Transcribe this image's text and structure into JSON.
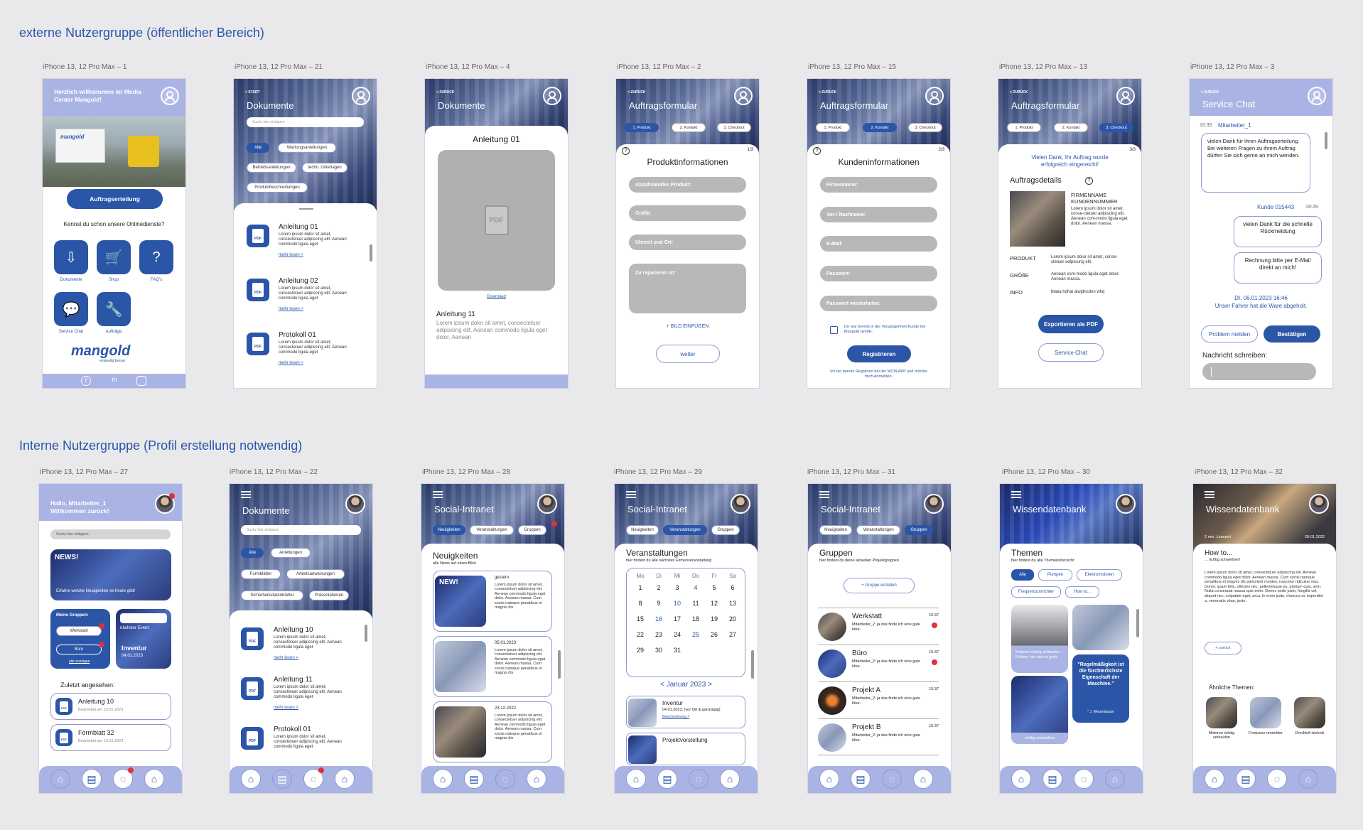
{
  "sections": {
    "external": "externe Nutzergruppe (öffentlicher Bereich)",
    "internal": "Interne Nutzergruppe (Profil erstellung notwendig)"
  },
  "labels": {
    "a1": "iPhone 13, 12 Pro Max – 1",
    "a21": "iPhone 13, 12 Pro Max – 21",
    "a4": "iPhone 13, 12 Pro Max – 4",
    "a2": "iPhone 13, 12 Pro Max – 2",
    "a15": "iPhone 13, 12 Pro Max – 15",
    "a13": "iPhone 13, 12 Pro Max – 13",
    "a3": "iPhone 13, 12 Pro Max – 3",
    "a27": "iPhone 13, 12 Pro Max – 27",
    "a22": "iPhone 13, 12 Pro Max – 22",
    "a28": "iPhone 13, 12 Pro Max – 28",
    "a29": "iPhone 13, 12 Pro Max – 29",
    "a31": "iPhone 13, 12 Pro Max – 31",
    "a30": "iPhone 13, 12 Pro Max – 30",
    "a32": "iPhone 13, 12 Pro Max – 32"
  },
  "colors": {
    "accent": "#2b56a8",
    "header": "#aab4e4",
    "field": "#b8b8b8",
    "alert": "#e0303c"
  },
  "icons": {
    "user": "user-icon",
    "home": "home-icon",
    "pdf": "pdf-icon",
    "chat": "chat-icon",
    "learn": "graduation-cap-icon"
  },
  "s1": {
    "welcome": "Herzlich willkommen im Media Center Mangold!",
    "cta": "Auftragserteilung",
    "question": "Kennst du schon unsere Onlinedienste?",
    "tiles": [
      "Dokumente",
      "Shop",
      "FAQ's",
      "Service Chat",
      "Aufträge"
    ],
    "logo": "mangold",
    "logo_sub": "eindeutig besser"
  },
  "s21": {
    "back": "< START",
    "title": "Dokumente",
    "search": "Suche hier eintippen",
    "filters": [
      "Alle",
      "Wartungsanleitungen",
      "Betriebsanleitungen",
      "techn. Unterlagen",
      "Produktbeschreibungen"
    ],
    "docs": [
      {
        "title": "Anleitung 01",
        "text": "Lorem ipsum dolor sit amet, consectetuer adipiscing elit. Aenean commodo ligula eget",
        "more": "mehr lesen >"
      },
      {
        "title": "Anleitung 02",
        "text": "Lorem ipsum dolor sit amet, consectetuer adipiscing elit. Aenean commodo ligula eget",
        "more": "mehr lesen >"
      },
      {
        "title": "Protokoll 01",
        "text": "Lorem ipsum dolor sit amet, consectetuer adipiscing elit. Aenean commodo ligula eget",
        "more": "mehr lesen >"
      }
    ]
  },
  "s4": {
    "back": "< ZURÜCK",
    "title": "Dokumente",
    "doc_title": "Anleitung 01",
    "pdf": "PDF",
    "download": "Download",
    "next_title": "Anleitung 11",
    "next_text": "Lorem ipsum dolor sit amet, consectetuer adipiscing elit. Aenean commodo ligula eget dolor. Aenean"
  },
  "form": {
    "back": "< ZURÜCK",
    "title": "Auftragsformular",
    "steps": [
      "1. Produkt",
      "2. Kontakt",
      "3. Checkout"
    ]
  },
  "s2": {
    "page": "1/3",
    "heading": "Produktinformationen",
    "fields": [
      "Abzuholendes Produkt:",
      "Größe:",
      "Uhrzeit und Ort:",
      "Zu reparieren ist:"
    ],
    "add_image": "+ BILD EINFÜGEN",
    "next": "weiter"
  },
  "s15": {
    "page": "2/3",
    "heading": "Kundeninformationen",
    "fields": [
      "Firmenname:",
      "Vor-/ Nachname:",
      "E-Mail:",
      "Passwort:",
      "Passwort wiederholen:"
    ],
    "checkbox": "Ich war bereits in der Vorgangenheit Kunde bei Mangold GmbH.",
    "register": "Registrieren",
    "login_note": "Ich bin bereits Registriert bei der MCM-APP und möchte mich Anmelden."
  },
  "s13": {
    "page": "3/3",
    "thanks": "Vielen Dank, Ihr Auftrag wurde erfolgreich eingereicht!",
    "heading": "Auftragsdetails",
    "company": "FIRMENNAME KUNDENNUMMER",
    "company_text": "Lorem ipsum dolor sit amet, conse-ctetuer adipiscing elit. Aenean com-modo ligula eget dolor. Aenean massa.",
    "rows": [
      {
        "k": "PRODUKT",
        "v": "Lorem ipsum dolor sit amet, conse-ctetuer adipiscing elit."
      },
      {
        "k": "GRÖßE",
        "v": "Aenean com-modo ligula eget dolor. Aenean massa."
      },
      {
        "k": "INFO",
        "v": "blaba hdhai  alwjdnsdnn whd"
      }
    ],
    "export": "Exportieren als PDF",
    "chat": "Service Chat"
  },
  "s3": {
    "back": "< ZURÜCK",
    "title": "Service Chat",
    "time1": "16:35",
    "agent": "Mitarbeiter_1",
    "msg1": "vielen Dank für ihren Auftragserteilung. Bei weiteren Fragen zu ihrem Auftrag dürfen Sie sich gerne an mich wenden.",
    "customer": "Kunde 015443",
    "time2": "19:29",
    "msg2": "vielen Dank für die schnelle Rückmeldung",
    "msg3": "Rechnung bitte per E-Mail direkt an mich!",
    "status_date": "DI, 06.01.2023 16:46",
    "status": "Unser Fahrer hat die Ware abgeholt.",
    "problem": "Problem melden",
    "confirm": "Bestätigen",
    "compose": "Nachricht schreiben:"
  },
  "s27": {
    "greeting": "Hallo, Mitarbeiter_1 Willkommen zurück!",
    "search": "Suche hier eintippen",
    "news_badge": "NEWS!",
    "news_text": "Erfahre welche Neuigkeiten es heute gibt!",
    "groups_title": "Meine Gruppen:",
    "groups": [
      "Werkstatt",
      "Büro"
    ],
    "groups_more": "alle anzeigen",
    "event_title": "nächster Event:",
    "event_name": "Inventur",
    "event_date": "04.01.2023",
    "recent_title": "Zuletzt angesehen:",
    "recent": [
      {
        "title": "Anleitung 10",
        "edited": "Bearbeitet am 15.01.2023"
      },
      {
        "title": "Formblatt 32",
        "edited": "Bearbeitet am 15.01.2023"
      }
    ]
  },
  "s22": {
    "title": "Dokumente",
    "search": "Suche hier eintippen",
    "filters": [
      "Alle",
      "Anleitungen",
      "Formblätter",
      "Arbeitsanweisungen",
      "Sicherheitsdatenblätter",
      "Präsentationen"
    ],
    "docs": [
      {
        "title": "Anleitung 10",
        "text": "Lorem ipsum dolor sit amet, consectetuer adipiscing elit. Aenean commodo ligula eget",
        "more": "mehr lesen >"
      },
      {
        "title": "Anleitung 11",
        "text": "Lorem ipsum dolor sit amet, consectetuer adipiscing elit. Aenean commodo ligula eget",
        "more": "mehr lesen >"
      },
      {
        "title": "Protokoll 01",
        "text": "Lorem ipsum dolor sit amet, consectetuer adipiscing elit. Aenean commodo ligula eget",
        "more": "mehr lesen >"
      }
    ]
  },
  "intranet": {
    "title": "Social-Intranet",
    "tabs": [
      "Neuigkeiten",
      "Veranstaltungen",
      "Gruppen"
    ]
  },
  "s28": {
    "heading": "Neuigkeiten",
    "sub": "alle News auf einen Blick",
    "badge": "NEW!",
    "posts": [
      {
        "date": "gestern",
        "text": "Lorem ipsum dolor sit amet, consectetuer adipiscing elit. Aenean commodo ligula eget dolor. Aenean massa. Cum sociis natoque penatibus et magnis dis"
      },
      {
        "date": "05.01.2023",
        "text": "Lorem ipsum dolor sit amet, consectetuer adipiscing elit. Aenean commodo ligula eget dolor. Aenean massa. Cum sociis natoque penatibus et magnis dis"
      },
      {
        "date": "23.12.2022",
        "text": "Lorem ipsum dolor sit amet, consectetuer adipiscing elit. Aenean commodo ligula eget dolor. Aenean massa. Cum sociis natoque penatibus et magnis dis"
      }
    ]
  },
  "s29": {
    "heading": "Veranstaltungen",
    "sub": "hier findest du alle nächsten Firmenveranstaltung",
    "weekdays": [
      "Mo",
      "Di",
      "Mi",
      "Do",
      "Fr",
      "Sa"
    ],
    "weeks": [
      [
        "1",
        "2",
        "3",
        "4",
        "5",
        "6"
      ],
      [
        "8",
        "9",
        "10",
        "11",
        "12",
        "13"
      ],
      [
        "15",
        "16",
        "17",
        "18",
        "19",
        "20"
      ],
      [
        "22",
        "23",
        "24",
        "25",
        "26",
        "27"
      ],
      [
        "29",
        "30",
        "31",
        "",
        "",
        ""
      ]
    ],
    "month": "< Januar 2023 >",
    "events": [
      {
        "title": "Inventur",
        "date": "04.01.2023, (vor Ort & ganztägig)",
        "more": "Beschreibung >"
      },
      {
        "title": "Projektvorstellung",
        "date": "",
        "more": ""
      }
    ]
  },
  "s31": {
    "heading": "Gruppen",
    "sub": "hier findest du deine aktuellen Projektgruppen",
    "create": "+ Gruppe erstellen",
    "groups": [
      {
        "name": "Werkstatt",
        "time": "15:37",
        "msg": "Mitarbeiter_2: ja das finde ich eine gute Idee."
      },
      {
        "name": "Büro",
        "time": "15:37",
        "msg": "Mitarbeiter_2: ja das finde ich eine gute Idee."
      },
      {
        "name": "Projekt A",
        "time": "15:37",
        "msg": "Mitarbeiter_2: ja das finde ich eine gute Idee."
      },
      {
        "name": "Projekt B",
        "time": "15:37",
        "msg": "Mitarbeiter_2: ja das finde ich eine gute Idee."
      }
    ]
  },
  "s30": {
    "title": "Wissendatenbank",
    "heading": "Themen",
    "sub": "hier findest du alle Themenübersicht",
    "filters": [
      "Alle",
      "Pumpen",
      "Elektromotoren",
      "Frequenzumrichter",
      "How to..."
    ],
    "card1": "Motoren richtig verkaufen - Erfahre hier wie es geht.",
    "quote": "\"Regelmäßigkeit ist die fürchterlichste Eigenschaft der Maschine.\"",
    "quote_author": "\" J. Weizenbaum",
    "card2": "richtig schweißen"
  },
  "s32": {
    "title": "Wissendatenbank",
    "read_time": "2 min. Lesezeit",
    "date": "09.01.2022",
    "heading": "How to...",
    "sub": "... richtig schweißen!",
    "body": "Lorem ipsum dolor sit amet, consectetuer adipiscing elit. Aenean commodo ligula eget dolor. Aenean massa. Cum sociis natoque penatibus et magnis dis parturient montes, nascetur ridiculus mus. Donec quam felis, ultricies nec, pellentesque eu, pretium quis, sem. Nulla consequat massa quis enim. Donec pede justo, fringilla vel, aliquet nec, vulputate eget, arcu. In enim justo, rhoncus ut, imperdiet a, venenatis vitae, justo.",
    "back": "< zurück",
    "related_title": "Ähnliche Themen:",
    "related": [
      "Motoren richtig verkaufen",
      "Frequenz-umrichter",
      "Druckluft-technik"
    ]
  }
}
